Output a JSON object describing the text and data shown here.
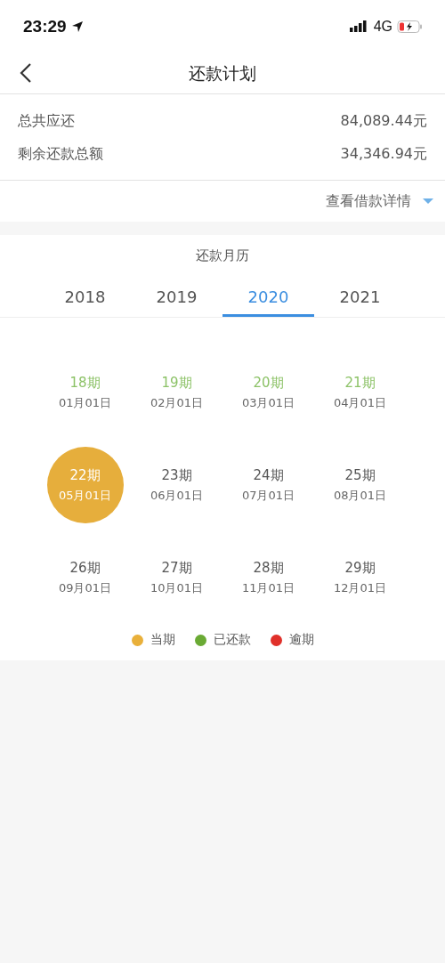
{
  "status_bar": {
    "time": "23:29",
    "network": "4G"
  },
  "nav": {
    "title": "还款计划"
  },
  "summary": [
    {
      "label": "总共应还",
      "value": "84,089.44元"
    },
    {
      "label": "剩余还款总额",
      "value": "34,346.94元"
    }
  ],
  "details_link": {
    "label": "查看借款详情"
  },
  "calendar": {
    "title": "还款月历",
    "years": [
      {
        "label": "2018",
        "selected": false
      },
      {
        "label": "2019",
        "selected": false
      },
      {
        "label": "2020",
        "selected": true
      },
      {
        "label": "2021",
        "selected": false
      }
    ],
    "periods": [
      {
        "period": "18期",
        "date": "01月01日",
        "kind": "paid"
      },
      {
        "period": "19期",
        "date": "02月01日",
        "kind": "paid"
      },
      {
        "period": "20期",
        "date": "03月01日",
        "kind": "paid"
      },
      {
        "period": "21期",
        "date": "04月01日",
        "kind": "paid"
      },
      {
        "period": "22期",
        "date": "05月01日",
        "kind": "current"
      },
      {
        "period": "23期",
        "date": "06月01日",
        "kind": "upcoming"
      },
      {
        "period": "24期",
        "date": "07月01日",
        "kind": "upcoming"
      },
      {
        "period": "25期",
        "date": "08月01日",
        "kind": "upcoming"
      },
      {
        "period": "26期",
        "date": "09月01日",
        "kind": "upcoming"
      },
      {
        "period": "27期",
        "date": "10月01日",
        "kind": "upcoming"
      },
      {
        "period": "28期",
        "date": "11月01日",
        "kind": "upcoming"
      },
      {
        "period": "29期",
        "date": "12月01日",
        "kind": "upcoming"
      }
    ],
    "legend": [
      {
        "label": "当期",
        "color": "#e9b03a"
      },
      {
        "label": "已还款",
        "color": "#6aaa34"
      },
      {
        "label": "逾期",
        "color": "#e0302a"
      }
    ]
  }
}
